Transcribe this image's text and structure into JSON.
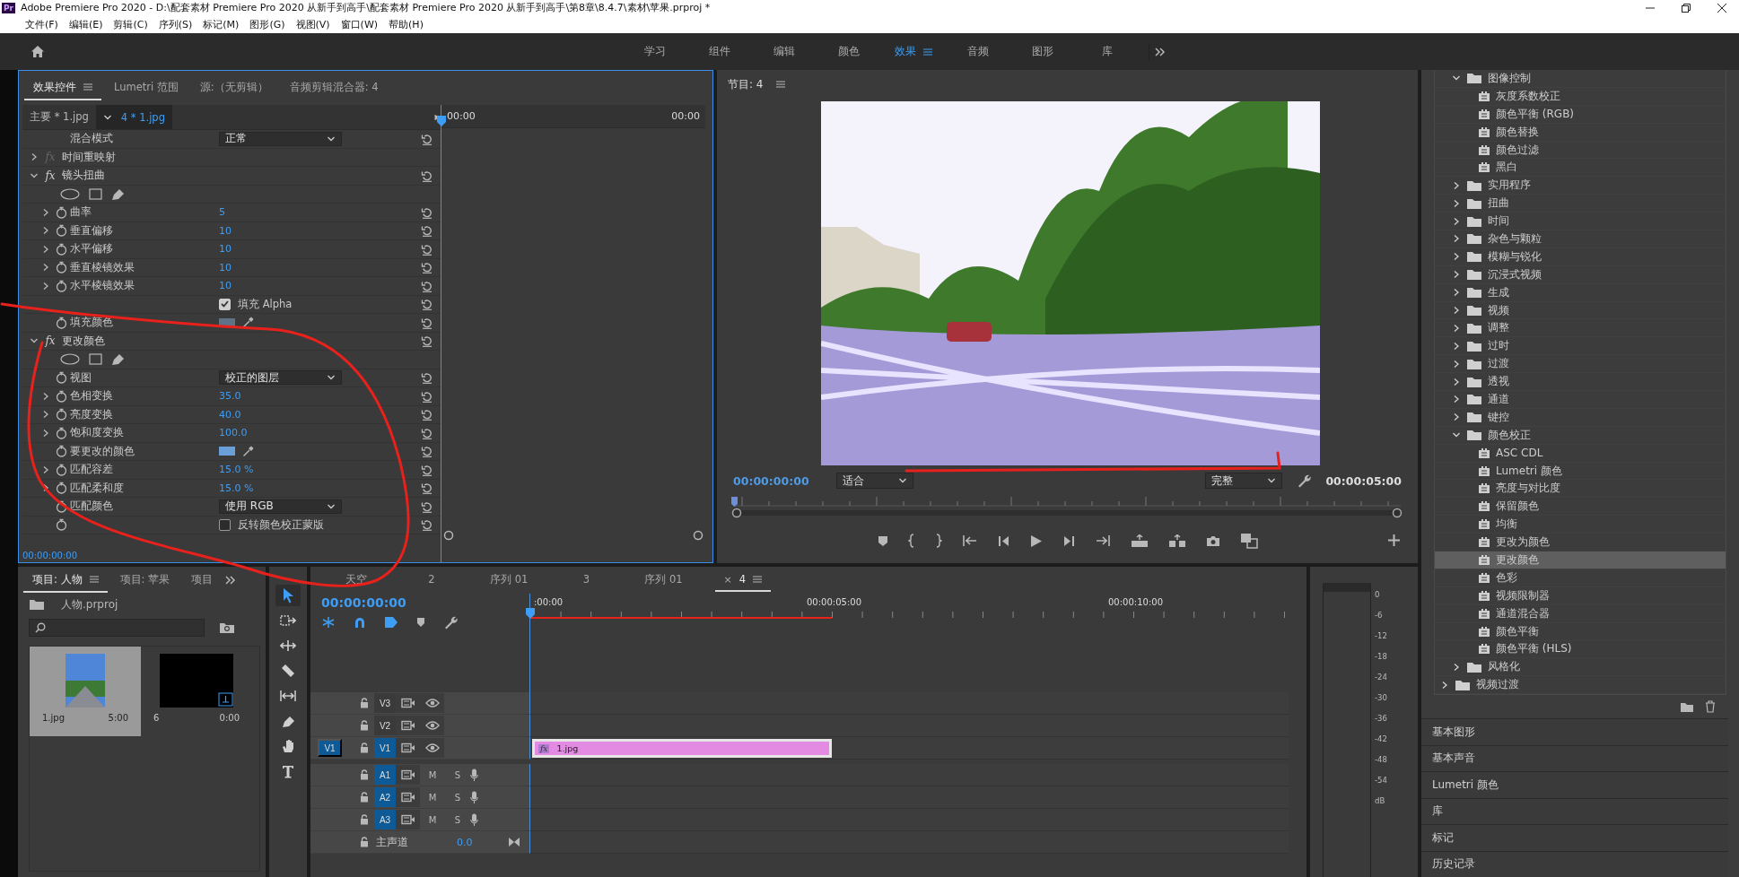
{
  "title_bar": {
    "logo": "Pr",
    "title": "Adobe Premiere Pro 2020 - D:\\配套素材 Premiere Pro 2020 从新手到高手\\配套素材 Premiere Pro 2020 从新手到高手\\第8章\\8.4.7\\素材\\苹果.prproj *"
  },
  "menu": [
    "文件(F)",
    "编辑(E)",
    "剪辑(C)",
    "序列(S)",
    "标记(M)",
    "图形(G)",
    "视图(V)",
    "窗口(W)",
    "帮助(H)"
  ],
  "workspaces": [
    {
      "label": "学习",
      "selected": false
    },
    {
      "label": "组件",
      "selected": false
    },
    {
      "label": "编辑",
      "selected": false
    },
    {
      "label": "颜色",
      "selected": false
    },
    {
      "label": "效果",
      "selected": true
    },
    {
      "label": "音频",
      "selected": false
    },
    {
      "label": "图形",
      "selected": false
    },
    {
      "label": "库",
      "selected": false
    }
  ],
  "effect_controls": {
    "tabs": [
      {
        "label": "效果控件",
        "selected": true
      },
      {
        "label": "Lumetri 范围",
        "selected": false
      },
      {
        "label": "源:（无剪辑）",
        "selected": false
      },
      {
        "label": "音频剪辑混合器: 4",
        "selected": false
      }
    ],
    "clip_master": "主要 * 1.jpg",
    "clip_sequence": "4 * 1.jpg",
    "ruler_start": "00:00",
    "ruler_end": "00:00",
    "rows": [
      {
        "kind": "dropdown",
        "name": "混合模式",
        "value": "正常",
        "stopwatch": false
      },
      {
        "kind": "section",
        "fx": "fx",
        "name": "时间重映射",
        "expanded": false,
        "fx_enabled": false,
        "reset": false
      },
      {
        "kind": "section",
        "fx": "fx",
        "name": "镜头扭曲",
        "expanded": true,
        "fx_enabled": true,
        "reset": true
      },
      {
        "kind": "masks"
      },
      {
        "kind": "param",
        "name": "曲率",
        "value": "5",
        "expandable": true
      },
      {
        "kind": "param",
        "name": "垂直偏移",
        "value": "10",
        "expandable": true
      },
      {
        "kind": "param",
        "name": "水平偏移",
        "value": "10",
        "expandable": true
      },
      {
        "kind": "param",
        "name": "垂直棱镜效果",
        "value": "10",
        "expandable": true
      },
      {
        "kind": "param",
        "name": "水平棱镜效果",
        "value": "10",
        "expandable": true
      },
      {
        "kind": "checkbox",
        "label": "填充 Alpha",
        "checked": true,
        "stopwatch": false
      },
      {
        "kind": "color",
        "name": "填充颜色",
        "color": "#5f7286"
      },
      {
        "kind": "section",
        "fx": "fx",
        "name": "更改颜色",
        "expanded": true,
        "fx_enabled": true,
        "reset": true
      },
      {
        "kind": "masks"
      },
      {
        "kind": "dropdown",
        "name": "视图",
        "value": "校正的图层",
        "stopwatch": true
      },
      {
        "kind": "param",
        "name": "色相变换",
        "value": "35.0",
        "expandable": true
      },
      {
        "kind": "param",
        "name": "亮度变换",
        "value": "40.0",
        "expandable": true
      },
      {
        "kind": "param",
        "name": "饱和度变换",
        "value": "100.0",
        "expandable": true
      },
      {
        "kind": "color",
        "name": "要更改的颜色",
        "color": "#6a9fd8"
      },
      {
        "kind": "param",
        "name": "匹配容差",
        "value": "15.0 %",
        "expandable": true
      },
      {
        "kind": "param",
        "name": "匹配柔和度",
        "value": "15.0 %",
        "expandable": true
      },
      {
        "kind": "dropdown",
        "name": "匹配颜色",
        "value": "使用 RGB",
        "stopwatch": true
      },
      {
        "kind": "checkbox",
        "label": "反转颜色校正蒙版",
        "checked": false,
        "stopwatch": true
      }
    ],
    "timecode": "00:00:00:00"
  },
  "program_monitor": {
    "title": "节目: 4",
    "timecode": "00:00:00:00",
    "zoom": "适合",
    "quality": "完整",
    "duration": "00:00:05:00"
  },
  "effects": {
    "tree": [
      {
        "kind": "scrolled_parent",
        "children": [
          {
            "kind": "folder",
            "name": "图像控制",
            "expanded": true,
            "selected": false,
            "children": [
              {
                "kind": "effect",
                "name": "灰度系数校正",
                "selected": false
              },
              {
                "kind": "effect",
                "name": "颜色平衡 (RGB)",
                "selected": false
              },
              {
                "kind": "effect",
                "name": "颜色替换",
                "selected": false
              },
              {
                "kind": "effect",
                "name": "颜色过滤",
                "selected": false
              },
              {
                "kind": "effect",
                "name": "黑白",
                "selected": false
              }
            ]
          },
          {
            "kind": "folder",
            "name": "实用程序",
            "expanded": false,
            "selected": false
          },
          {
            "kind": "folder",
            "name": "扭曲",
            "expanded": false,
            "selected": false
          },
          {
            "kind": "folder",
            "name": "时间",
            "expanded": false,
            "selected": false
          },
          {
            "kind": "folder",
            "name": "杂色与颗粒",
            "expanded": false,
            "selected": false
          },
          {
            "kind": "folder",
            "name": "模糊与锐化",
            "expanded": false,
            "selected": false
          },
          {
            "kind": "folder",
            "name": "沉浸式视频",
            "expanded": false,
            "selected": false
          },
          {
            "kind": "folder",
            "name": "生成",
            "expanded": false,
            "selected": false
          },
          {
            "kind": "folder",
            "name": "视频",
            "expanded": false,
            "selected": false
          },
          {
            "kind": "folder",
            "name": "调整",
            "expanded": false,
            "selected": false
          },
          {
            "kind": "folder",
            "name": "过时",
            "expanded": false,
            "selected": false
          },
          {
            "kind": "folder",
            "name": "过渡",
            "expanded": false,
            "selected": false
          },
          {
            "kind": "folder",
            "name": "透视",
            "expanded": false,
            "selected": false
          },
          {
            "kind": "folder",
            "name": "通道",
            "expanded": false,
            "selected": false
          },
          {
            "kind": "folder",
            "name": "键控",
            "expanded": false,
            "selected": false
          },
          {
            "kind": "folder",
            "name": "颜色校正",
            "expanded": true,
            "selected": false,
            "children": [
              {
                "kind": "effect",
                "name": "ASC CDL",
                "selected": false
              },
              {
                "kind": "effect",
                "name": "Lumetri 颜色",
                "selected": false
              },
              {
                "kind": "effect",
                "name": "亮度与对比度",
                "selected": false
              },
              {
                "kind": "effect",
                "name": "保留颜色",
                "selected": false
              },
              {
                "kind": "effect",
                "name": "均衡",
                "selected": false
              },
              {
                "kind": "effect",
                "name": "更改为颜色",
                "selected": false
              },
              {
                "kind": "effect",
                "name": "更改颜色",
                "selected": true
              },
              {
                "kind": "effect",
                "name": "色彩",
                "selected": false
              },
              {
                "kind": "effect",
                "name": "视频限制器",
                "selected": false
              },
              {
                "kind": "effect",
                "name": "通道混合器",
                "selected": false
              },
              {
                "kind": "effect",
                "name": "颜色平衡",
                "selected": false
              },
              {
                "kind": "effect",
                "name": "颜色平衡 (HLS)",
                "selected": false
              }
            ]
          },
          {
            "kind": "folder",
            "name": "风格化",
            "expanded": false,
            "selected": false
          }
        ]
      },
      {
        "kind": "folder",
        "name": "视频过渡",
        "expanded": false,
        "selected": false
      }
    ],
    "panels": [
      "基本图形",
      "基本声音",
      "Lumetri 颜色",
      "库",
      "标记",
      "历史记录"
    ]
  },
  "project": {
    "tabs": [
      {
        "label": "项目: 人物",
        "selected": true
      },
      {
        "label": "项目: 苹果",
        "selected": false
      },
      {
        "label": "项目",
        "selected": false
      }
    ],
    "file": "人物.prproj",
    "items": [
      {
        "kind": "image",
        "name": "1.jpg",
        "duration": "5:00",
        "selected": true
      },
      {
        "kind": "sequence",
        "name": "6",
        "duration": "0:00",
        "selected": false
      }
    ]
  },
  "tools": [
    {
      "kind": "selection",
      "selected": true
    },
    {
      "kind": "track_select",
      "selected": false
    },
    {
      "kind": "ripple",
      "selected": false
    },
    {
      "kind": "razor",
      "selected": false
    },
    {
      "kind": "slip",
      "selected": false
    },
    {
      "kind": "pen",
      "selected": false
    },
    {
      "kind": "hand",
      "selected": false
    },
    {
      "kind": "type",
      "selected": false
    }
  ],
  "timeline": {
    "tabs": [
      {
        "label": "天空",
        "selected": false
      },
      {
        "label": "2",
        "selected": false
      },
      {
        "label": "序列 01",
        "selected": false
      },
      {
        "label": "3",
        "selected": false
      },
      {
        "label": "序列 01",
        "selected": false
      },
      {
        "label": "4",
        "selected": true,
        "close": "×"
      }
    ],
    "timecode": "00:00:00:00",
    "ruler": [
      ":00:00",
      "00:00:05:00",
      "00:00:10:00"
    ],
    "tracks": [
      {
        "kind": "video",
        "name": "V3",
        "targeted": false
      },
      {
        "kind": "video",
        "name": "V2",
        "targeted": false
      },
      {
        "kind": "video",
        "name": "V1",
        "targeted": true,
        "source": "V1",
        "clips": [
          {
            "fx": "fx",
            "name": "1.jpg"
          }
        ]
      },
      {
        "kind": "audio",
        "name": "A1",
        "targeted": true,
        "mute": "M",
        "solo": "S"
      },
      {
        "kind": "audio",
        "name": "A2",
        "targeted": true,
        "mute": "M",
        "solo": "S"
      },
      {
        "kind": "audio",
        "name": "A3",
        "targeted": true,
        "mute": "M",
        "solo": "S"
      }
    ],
    "master": {
      "name": "主声道",
      "value": "0.0"
    }
  },
  "meter": {
    "scale": [
      "0",
      "-6",
      "-12",
      "-18",
      "-24",
      "-30",
      "-36",
      "-42",
      "-48",
      "-54",
      "dB"
    ]
  }
}
